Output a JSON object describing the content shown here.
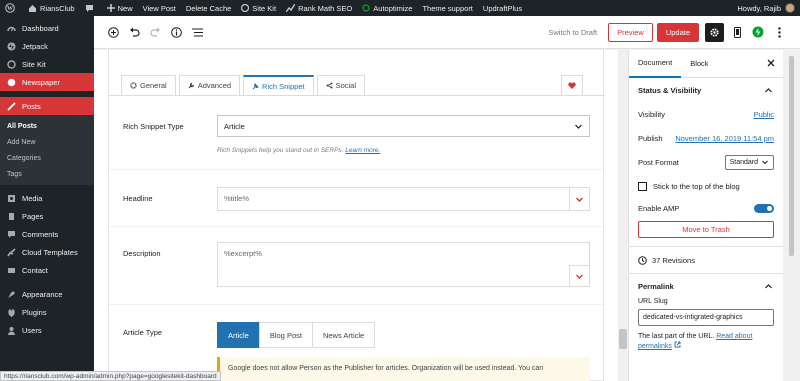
{
  "adminbar": {
    "site_name": "RiansClub",
    "comment_count": "",
    "new_label": "New",
    "view_post": "View Post",
    "delete_cache": "Delete Cache",
    "site_kit": "Site Kit",
    "rank_math": "Rank Math SEO",
    "autoptimize": "Autoptimize",
    "theme_support": "Theme support",
    "updraftplus": "UpdraftPlus",
    "howdy": "Howdy, Rajib"
  },
  "sidebar": {
    "items": [
      {
        "label": "Dashboard",
        "icon": "dashboard-icon"
      },
      {
        "label": "Jetpack",
        "icon": "jetpack-icon"
      },
      {
        "label": "Site Kit",
        "icon": "sitekit-icon"
      },
      {
        "label": "Newspaper",
        "icon": "newspaper-icon"
      },
      {
        "label": "Posts",
        "icon": "posts-icon"
      },
      {
        "label": "Media",
        "icon": "media-icon"
      },
      {
        "label": "Pages",
        "icon": "pages-icon"
      },
      {
        "label": "Comments",
        "icon": "comments-icon"
      },
      {
        "label": "Cloud Templates",
        "icon": "cloud-templates-icon"
      },
      {
        "label": "Contact",
        "icon": "contact-icon"
      },
      {
        "label": "Appearance",
        "icon": "appearance-icon"
      },
      {
        "label": "Plugins",
        "icon": "plugins-icon"
      },
      {
        "label": "Users",
        "icon": "users-icon"
      }
    ],
    "submenu": [
      "All Posts",
      "Add New",
      "Categories",
      "Tags"
    ]
  },
  "toolbar": {
    "switch_to_draft": "Switch to Draft",
    "preview": "Preview",
    "update": "Update"
  },
  "tabs": {
    "general": "General",
    "advanced": "Advanced",
    "rich_snippet": "Rich Snippet",
    "social": "Social"
  },
  "form": {
    "rich_snippet_type_label": "Rich Snippet Type",
    "rich_snippet_type_value": "Article",
    "rich_snippet_help": "Rich Snippets help you stand out in SERPs.",
    "learn_more": "Learn more.",
    "headline_label": "Headline",
    "headline_value": "%title%",
    "description_label": "Description",
    "description_value": "%excerpt%",
    "article_type_label": "Article Type",
    "article_types": [
      "Article",
      "Blog Post",
      "News Article"
    ],
    "notice": "Google does not allow Person as the Publisher for articles. Organization will be used instead. You can"
  },
  "settings": {
    "tab_document": "Document",
    "tab_block": "Block",
    "status_visibility": "Status & Visibility",
    "visibility_label": "Visibility",
    "visibility_value": "Public",
    "publish_label": "Publish",
    "publish_value": "November 16, 2019 11:54 pm",
    "post_format_label": "Post Format",
    "post_format_value": "Standard",
    "stick_to_top": "Stick to the top of the blog",
    "enable_amp": "Enable AMP",
    "move_to_trash": "Move to Trash",
    "revisions": "37 Revisions",
    "permalink": "Permalink",
    "url_slug_label": "URL Slug",
    "url_slug_value": "dedicated-vs-intigrated-graphics",
    "slug_help": "The last part of the URL.",
    "read_about": "Read about permalinks"
  },
  "statusbar": {
    "url": "https://riansclub.com/wp-admin/admin.php?page=googlesitekit-dashboard"
  },
  "colors": {
    "admin_dark": "#1d2327",
    "accent_red": "#d63638",
    "wp_blue": "#2271b1"
  }
}
